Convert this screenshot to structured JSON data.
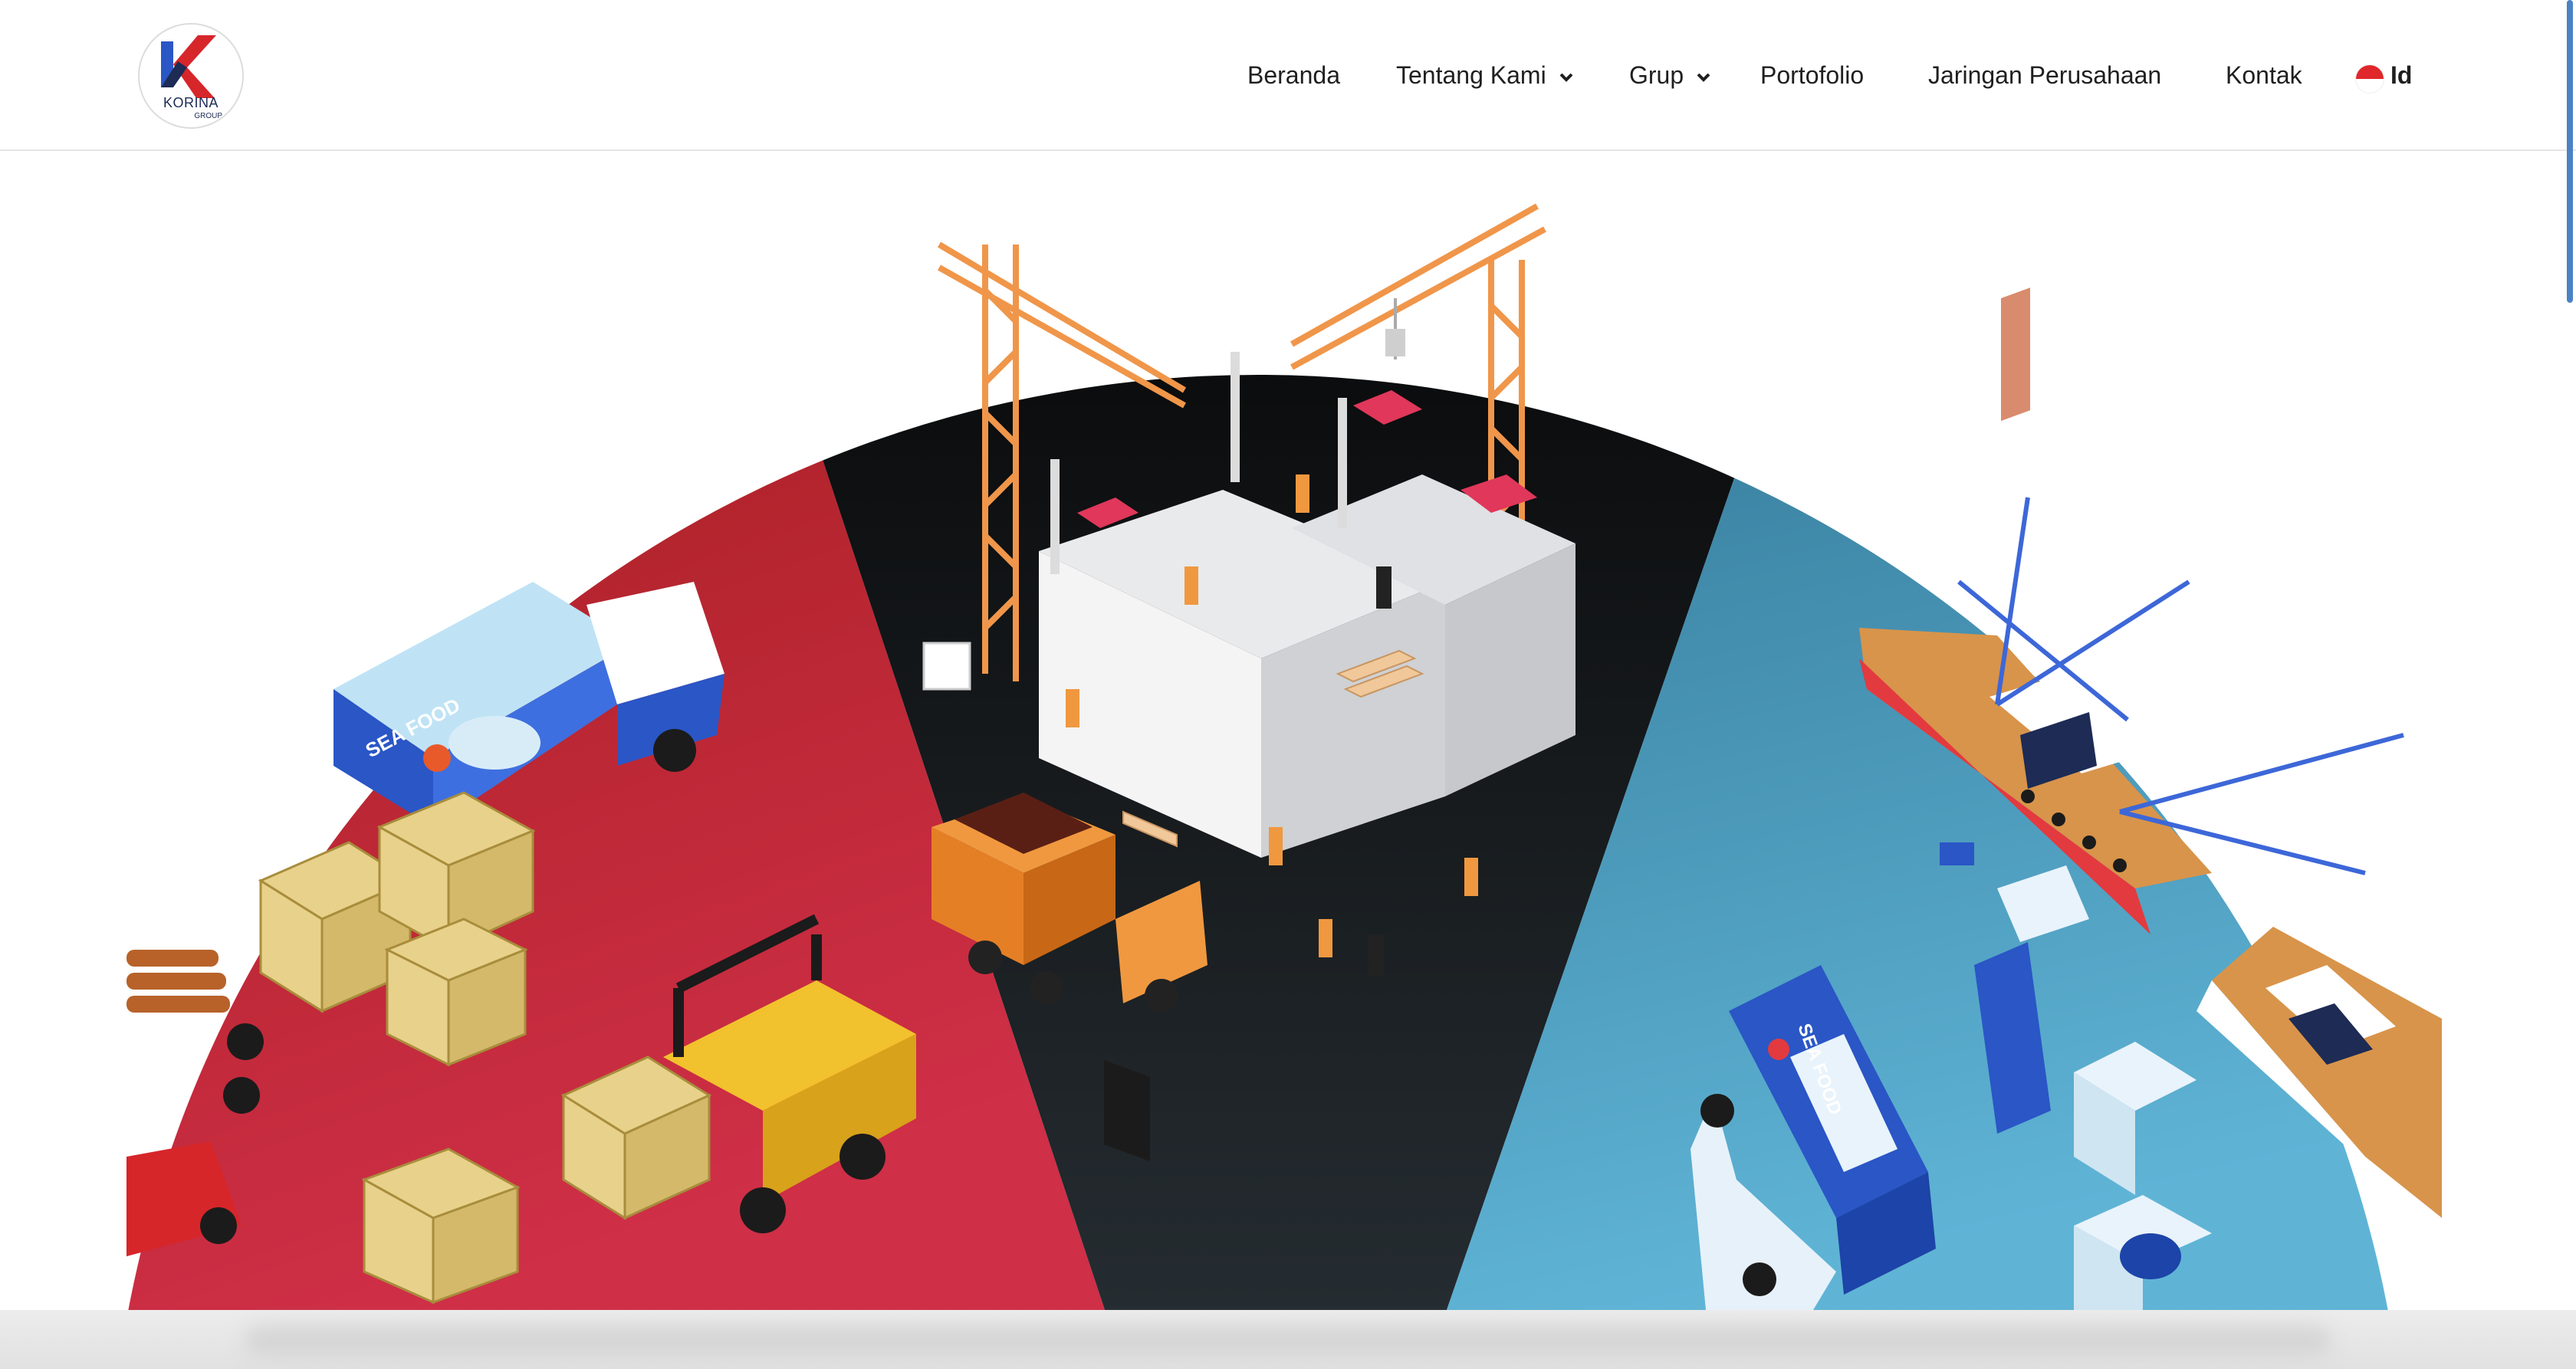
{
  "brand": {
    "name": "KORINA",
    "sub": "GROUP",
    "colors": {
      "red": "#d6262a",
      "blue": "#2a56c6",
      "navy": "#1d2b55"
    }
  },
  "nav": {
    "items": [
      {
        "label": "Beranda",
        "has_dropdown": false
      },
      {
        "label": "Tentang Kami",
        "has_dropdown": true
      },
      {
        "label": "Grup",
        "has_dropdown": true
      },
      {
        "label": "Portofolio",
        "has_dropdown": false
      },
      {
        "label": "Jaringan Perusahaan",
        "has_dropdown": false
      },
      {
        "label": "Kontak",
        "has_dropdown": false
      }
    ],
    "language": {
      "label": "Id",
      "flag_colors": [
        "#e0272b",
        "#ffffff"
      ]
    }
  },
  "hero": {
    "sectors": [
      {
        "name": "logistics",
        "color": "#b5231f"
      },
      {
        "name": "construction",
        "color": "#0b0b0b"
      },
      {
        "name": "fishery",
        "color": "#3f86a9"
      }
    ],
    "truck_labels": [
      "SEA FOOD",
      "SEA FOOD"
    ]
  }
}
